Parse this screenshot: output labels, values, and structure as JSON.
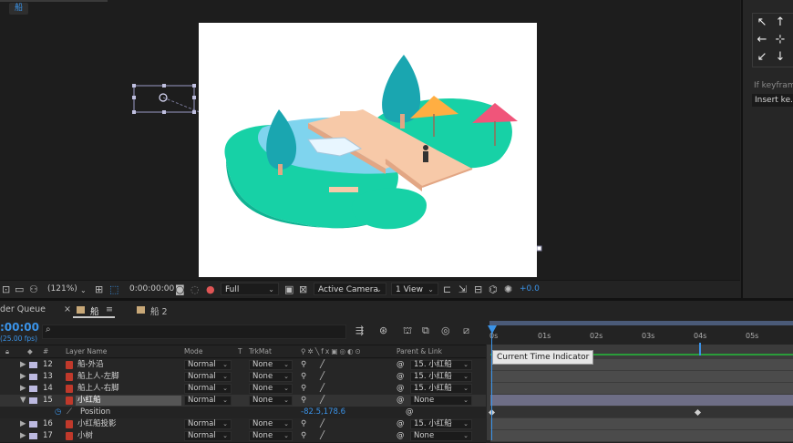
{
  "viewer": {
    "comp_tab": "船",
    "toolbar": {
      "zoom": "(121%)",
      "timecode": "0:00:00:00",
      "resolution": "Full",
      "camera": "Active Camera",
      "view": "1 View",
      "exposure": "+0.0"
    }
  },
  "right_panel": {
    "keyframe_text": "If keyframe",
    "insert_button": "Insert ke..."
  },
  "timeline": {
    "tabs": [
      {
        "label": "der Queue"
      },
      {
        "label": "船",
        "swatch": "#c8a878"
      },
      {
        "label": "船 2",
        "swatch": "#c8a878"
      }
    ],
    "close_glyph": "×",
    "menu_glyph": "≡",
    "current_time": ":00:00",
    "fps": "(25.00 fps)",
    "headers": {
      "num": "#",
      "layer_name": "Layer Name",
      "mode": "Mode",
      "t": "T",
      "trkmat": "TrkMat",
      "parent": "Parent & Link"
    },
    "layers": [
      {
        "num": "12",
        "name": "船-外沿",
        "mode": "Normal",
        "trkmat": "None",
        "parent": "15. 小红船"
      },
      {
        "num": "13",
        "name": "船上人-左脚",
        "mode": "Normal",
        "trkmat": "None",
        "parent": "15. 小红船"
      },
      {
        "num": "14",
        "name": "船上人-右脚",
        "mode": "Normal",
        "trkmat": "None",
        "parent": "15. 小红船"
      },
      {
        "num": "15",
        "name": "小红船",
        "mode": "Normal",
        "trkmat": "None",
        "parent": "None"
      },
      {
        "num": "16",
        "name": "小红船投影",
        "mode": "Normal",
        "trkmat": "None",
        "parent": "15. 小红船"
      },
      {
        "num": "17",
        "name": "小树",
        "mode": "Normal",
        "trkmat": "None",
        "parent": "None"
      }
    ],
    "position_property": {
      "label": "Position",
      "value": "-82.5,178.6"
    },
    "ruler_ticks": [
      "0s",
      "01s",
      "02s",
      "03s",
      "04s",
      "05s"
    ],
    "tooltip": "Current Time Indicator"
  },
  "colors": {
    "accent": "#3a93e8",
    "label_lavender": "#bcb9e0",
    "keyframe_green": "#2a9c3a"
  }
}
